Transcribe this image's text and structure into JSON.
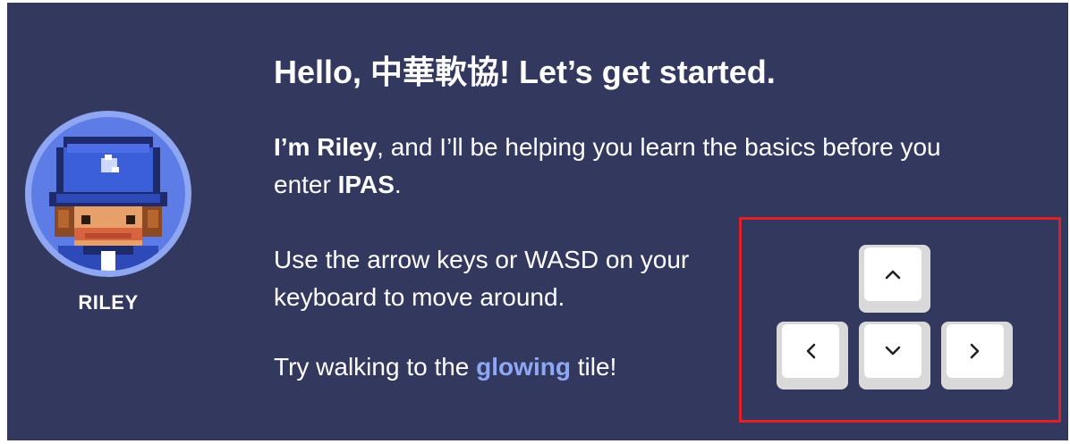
{
  "dialog": {
    "title": "Hello, 中華軟協! Let’s get started.",
    "intro_bold": "I’m Riley",
    "intro_rest": ", and I’ll be helping you learn the basics before you enter ",
    "intro_bold2": "IPAS",
    "intro_end": ".",
    "instructions": "Use the arrow keys or WASD on your keyboard to move around.",
    "try_prefix": "Try walking to the ",
    "try_highlight": "glowing",
    "try_suffix": " tile!"
  },
  "guide": {
    "name": "RILEY",
    "avatar_icon": "riley-pixel-avatar"
  },
  "keys": [
    {
      "name": "up",
      "icon": "chevron-up-icon"
    },
    {
      "name": "left",
      "icon": "chevron-left-icon"
    },
    {
      "name": "down",
      "icon": "chevron-down-icon"
    },
    {
      "name": "right",
      "icon": "chevron-right-icon"
    }
  ],
  "colors": {
    "panel_bg": "#33385f",
    "highlight_text": "#8ea8f5",
    "avatar_ring": "#8fa6f2",
    "focus_outline": "#e01f26",
    "key_face": "#ffffff",
    "key_edge": "#d9d9d9"
  }
}
